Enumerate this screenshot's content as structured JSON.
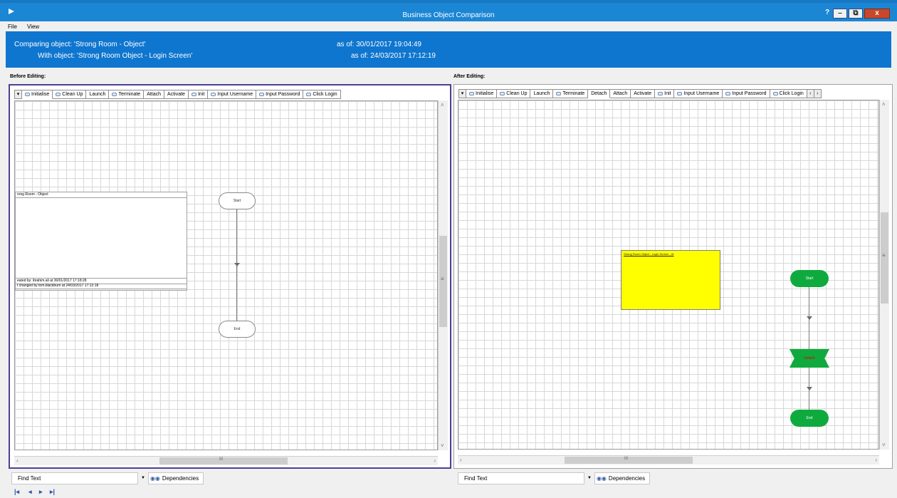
{
  "window": {
    "title": "Business Object Comparison",
    "help_label": "?",
    "minimize_label": "–",
    "restore_label": "⧉",
    "close_label": "x"
  },
  "menu": {
    "items": [
      "File",
      "View"
    ]
  },
  "info": {
    "comparing": "Comparing object: 'Strong Room - Object'",
    "with": "With object: 'Strong Room Object - Login Screen'",
    "date_before": "as of: 30/01/2017 19:04:49",
    "date_after": "as of: 24/03/2017 17:12:19"
  },
  "left_pane": {
    "label": "Before Editing:",
    "tabs": [
      "Initialise",
      "Clean Up",
      "Launch",
      "Terminate",
      "Attach",
      "Activate",
      "Init",
      "Input Username",
      "Input Password",
      "Click Login"
    ],
    "tab_icons": [
      true,
      true,
      false,
      true,
      false,
      false,
      true,
      true,
      true,
      true
    ],
    "active_tab": "Initialise",
    "info_box": {
      "title": "rong Room - Object",
      "created": "eated by: ibrahim.ali at 30/01/2017 17:18:28",
      "changed": "t changed by tom.blackburn at 24/03/2017 17:12:18"
    },
    "stages": {
      "start": "Start",
      "end": "End"
    },
    "scrollbar": {
      "grip": "III"
    }
  },
  "right_pane": {
    "label": "After Editing:",
    "tabs": [
      "Initialise",
      "Clean Up",
      "Launch",
      "Terminate",
      "Detach",
      "Attach",
      "Activate",
      "Init",
      "Input Username",
      "Input Password",
      "Click Login"
    ],
    "tab_icons": [
      true,
      true,
      false,
      true,
      false,
      false,
      false,
      true,
      true,
      true,
      true
    ],
    "active_tab": "Detach",
    "note": "Strong Room Object - Login Screen - At",
    "stages": {
      "start": "Start",
      "action": "Detach",
      "end": "End"
    },
    "scrollbar": {
      "grip": "III"
    }
  },
  "bottom": {
    "find_placeholder": "Find Text",
    "dependencies_label": "Dependencies"
  },
  "nav": {
    "first": "|◂",
    "prev": "◂",
    "next": "▸",
    "last": "▸|"
  },
  "colors": {
    "title_bar": "#1b86d4",
    "info_bar": "#0f76cf",
    "stage_green": "#0faa3e",
    "note_yellow": "#ffff00",
    "selection_border": "#4e3f95",
    "close_button": "#c7482a"
  }
}
